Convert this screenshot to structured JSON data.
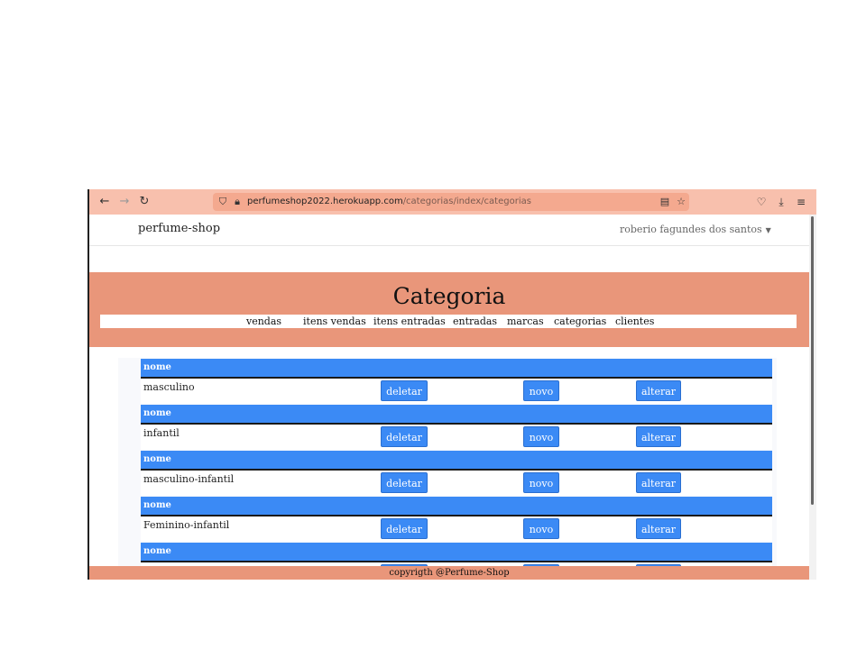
{
  "browser": {
    "url_host": "perfumeshop2022.herokuapp.com",
    "url_path": "/categorias/index/categorias"
  },
  "navbar": {
    "brand": "perfume-shop",
    "user": "roberio fagundes dos santos"
  },
  "page": {
    "title": "Categoria"
  },
  "menu": [
    "vendas",
    "itens vendas",
    "itens entradas",
    "entradas",
    "marcas",
    "categorias",
    "clientes"
  ],
  "table": {
    "header_label": "nome",
    "actions": {
      "delete": "deletar",
      "new": "novo",
      "edit": "alterar"
    },
    "rows": [
      "masculino",
      "infantil",
      "masculino-infantil",
      "Feminino-infantil",
      ""
    ]
  },
  "footer": {
    "text": "copyrigth @Perfume-Shop"
  },
  "colors": {
    "hero": "#e9967a",
    "header_blue": "#3b8af5",
    "toolbar": "#f8c0ad"
  }
}
